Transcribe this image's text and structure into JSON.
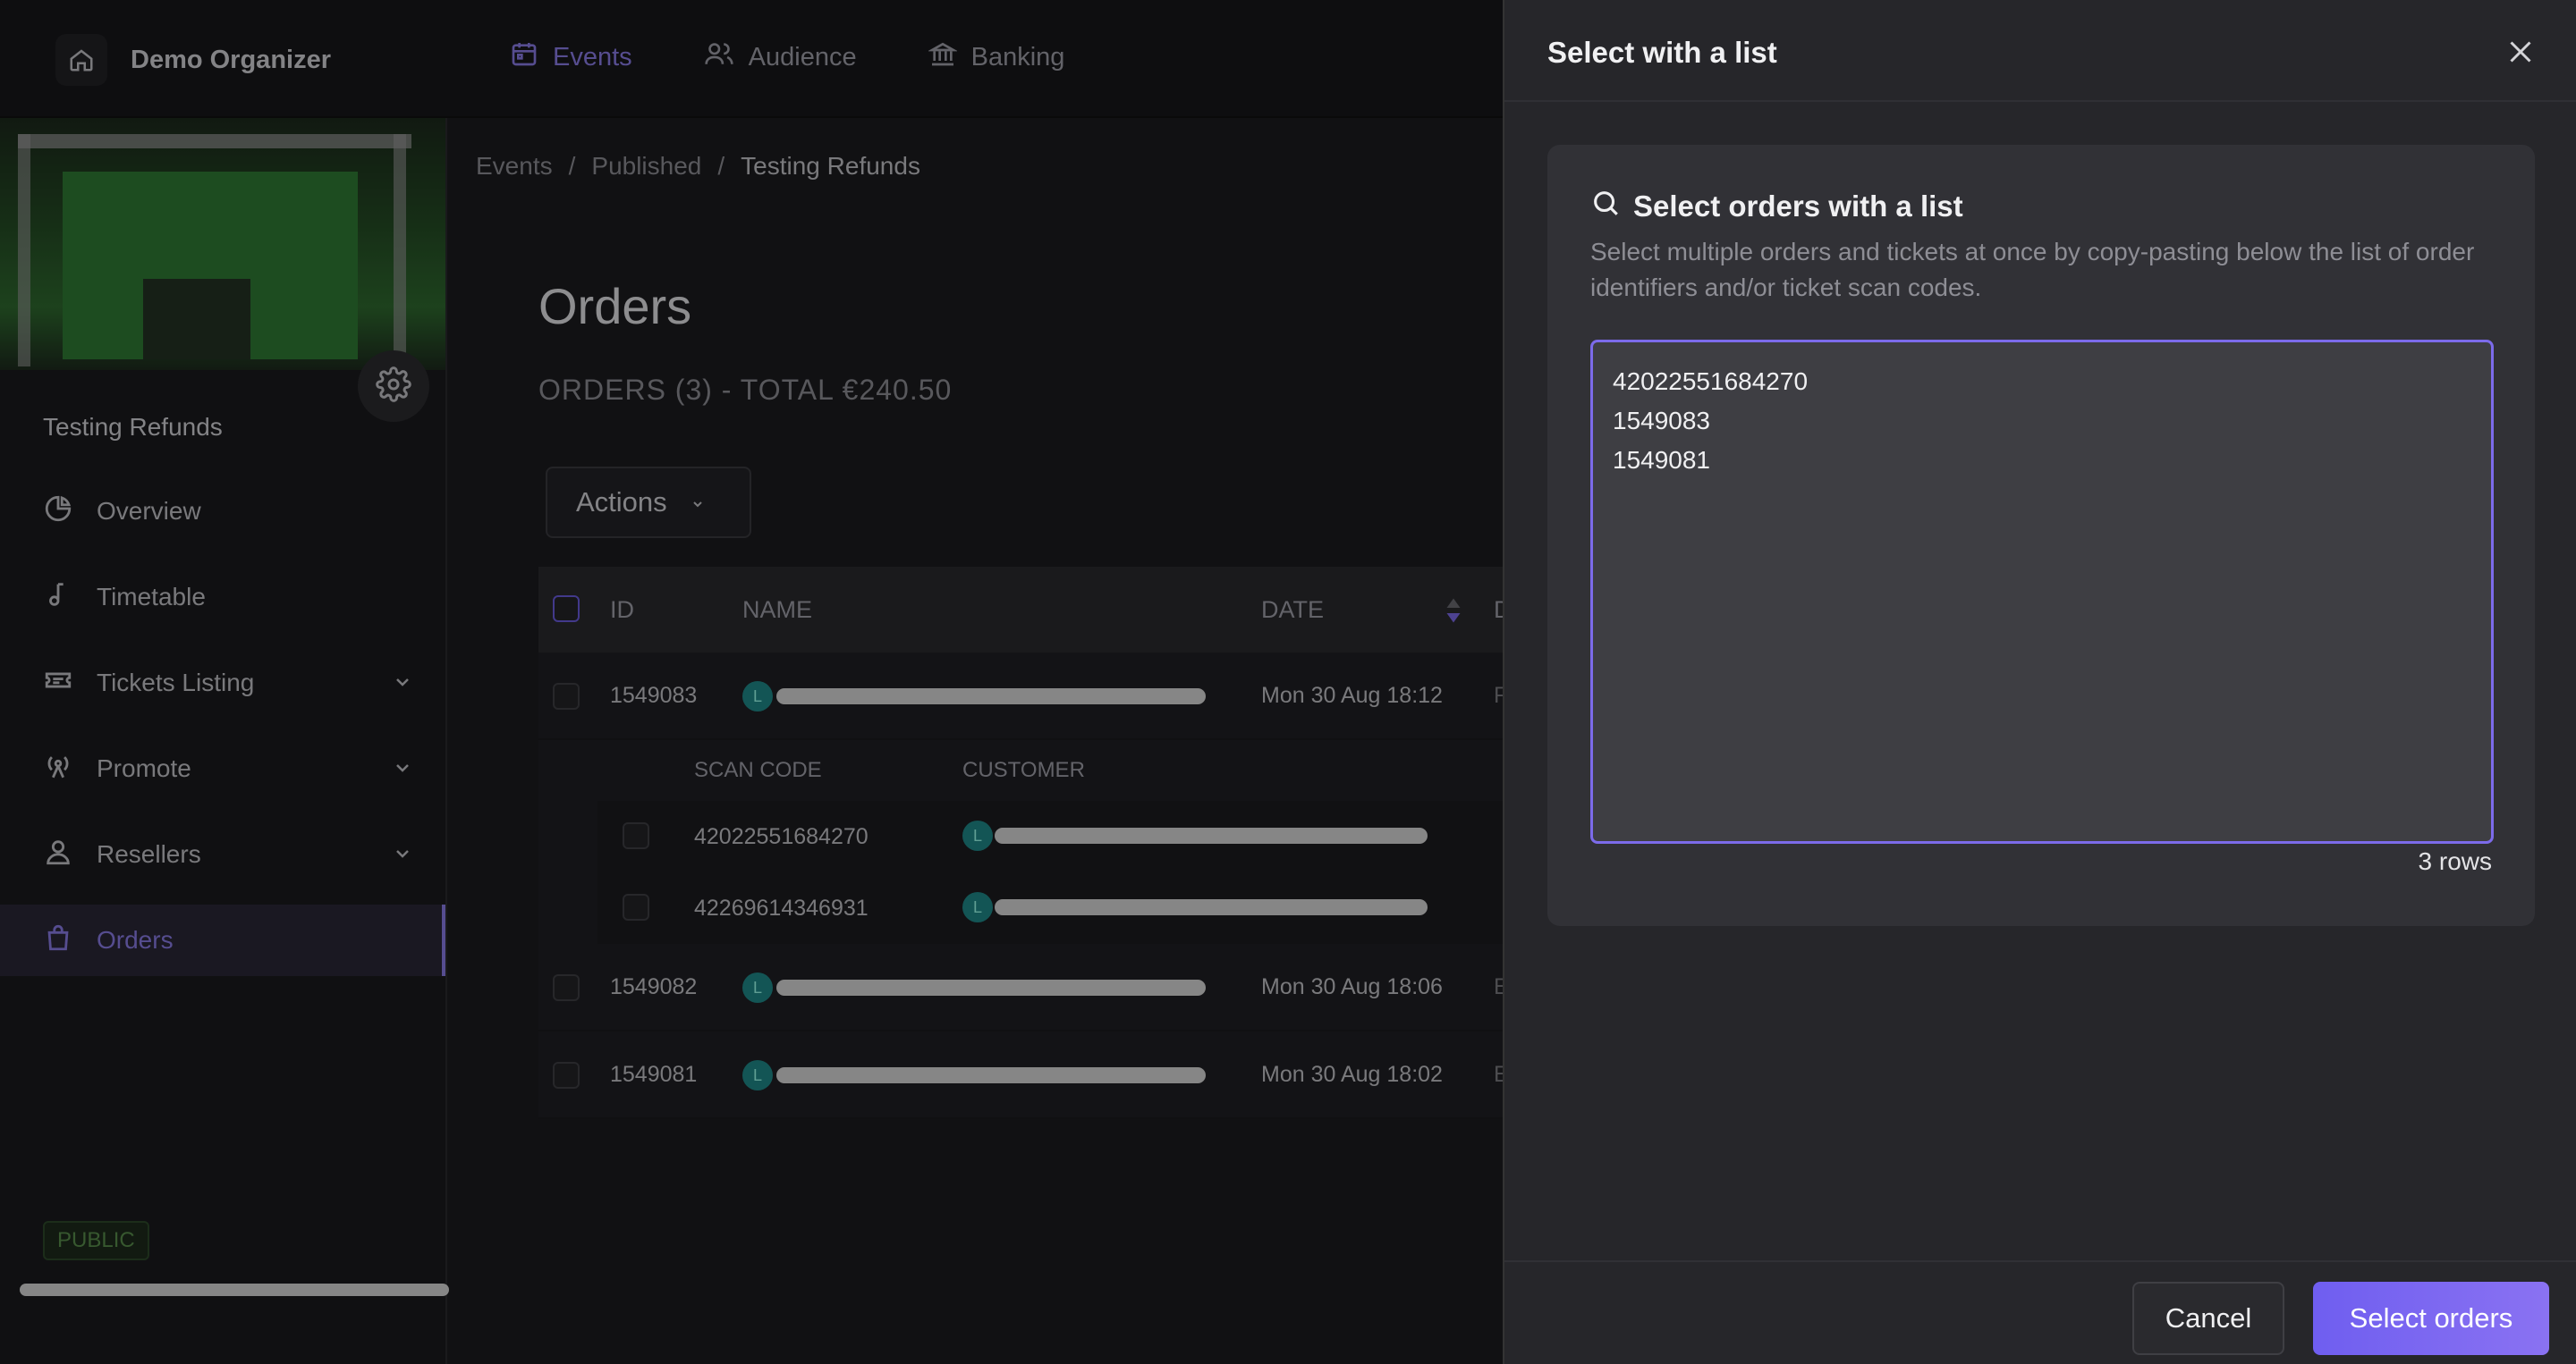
{
  "topnav": {
    "org_name": "Demo Organizer",
    "links": [
      {
        "label": "Events",
        "icon": "calendar-icon",
        "active": true
      },
      {
        "label": "Audience",
        "icon": "users-icon",
        "active": false
      },
      {
        "label": "Banking",
        "icon": "bank-icon",
        "active": false
      }
    ]
  },
  "sidebar": {
    "event_name": "Testing Refunds",
    "items": [
      {
        "label": "Overview",
        "icon": "pie-chart-icon"
      },
      {
        "label": "Timetable",
        "icon": "music-note-icon"
      },
      {
        "label": "Tickets Listing",
        "icon": "ticket-icon"
      },
      {
        "label": "Promote",
        "icon": "broadcast-icon"
      },
      {
        "label": "Resellers",
        "icon": "user-icon"
      },
      {
        "label": "Orders",
        "icon": "shopping-bag-icon"
      }
    ],
    "public_badge": "PUBLIC"
  },
  "main": {
    "breadcrumb": [
      "Events",
      "Published",
      "Testing Refunds"
    ],
    "title": "Orders",
    "summary": "ORDERS (3) - TOTAL €240.50",
    "actions_label": "Actions",
    "table": {
      "headers": [
        "ID",
        "NAME",
        "DATE",
        "D"
      ],
      "rows": [
        {
          "id": "1549083",
          "avatar": "L",
          "date": "Mon 30 Aug 18:12",
          "extra": "F"
        },
        {
          "id": "1549082",
          "avatar": "L",
          "date": "Mon 30 Aug 18:06",
          "extra": "E"
        },
        {
          "id": "1549081",
          "avatar": "L",
          "date": "Mon 30 Aug 18:02",
          "extra": "E"
        }
      ],
      "subtable": {
        "headers": [
          "SCAN CODE",
          "CUSTOMER"
        ],
        "rows": [
          {
            "scan_code": "42022551684270",
            "avatar": "L"
          },
          {
            "scan_code": "42269614346931",
            "avatar": "L"
          }
        ]
      }
    }
  },
  "drawer": {
    "title": "Select with a list",
    "card_title": "Select orders with a list",
    "card_desc": "Select multiple orders and tickets at once by copy-pasting below the list of order identifiers and/or ticket scan codes.",
    "textarea_value": "42022551684270\n1549083\n1549081",
    "rows_count": "3 rows",
    "cancel_label": "Cancel",
    "submit_label": "Select orders"
  },
  "colors": {
    "accent": "#8b7ce8",
    "primary_button": "#7565f0",
    "background": "#1c1c1f",
    "drawer": "#26262a"
  }
}
